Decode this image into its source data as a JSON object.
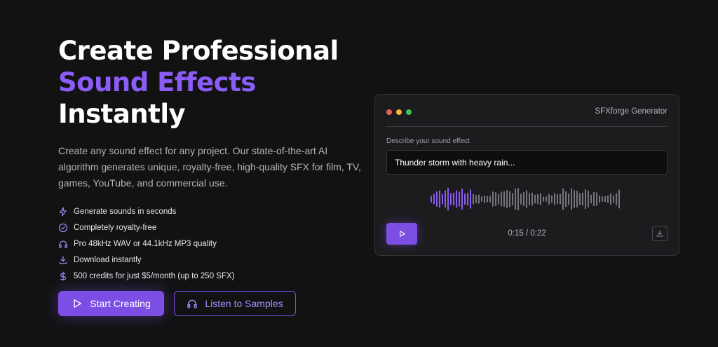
{
  "hero": {
    "title_line1": "Create Professional",
    "title_accent": "Sound Effects",
    "title_line3": "Instantly",
    "description": "Create any sound effect for any project. Our state-of-the-art AI algorithm generates unique, royalty-free, high-quality SFX for film, TV, games, YouTube, and commercial use."
  },
  "features": [
    {
      "icon": "lightning-icon",
      "text": "Generate sounds in seconds"
    },
    {
      "icon": "check-circle-icon",
      "text": "Completely royalty-free"
    },
    {
      "icon": "headphones-icon",
      "text": "Pro 48kHz WAV or 44.1kHz MP3 quality"
    },
    {
      "icon": "download-icon",
      "text": "Download instantly"
    },
    {
      "icon": "dollar-icon",
      "text": "500 credits for just $5/month (up to 250 SFX)"
    }
  ],
  "cta": {
    "primary_label": "Start Creating",
    "secondary_label": "Listen to Samples"
  },
  "generator": {
    "title": "SFXforge Generator",
    "input_label": "Describe your sound effect",
    "input_value": "Thunder storm with heavy rain...",
    "time": "0:15 / 0:22",
    "window_dots": [
      "#ed5f56",
      "#f5b43c",
      "#3fc353"
    ]
  },
  "colors": {
    "accent": "#8b5cf6",
    "button": "#7c4ee4",
    "background": "#121212"
  }
}
